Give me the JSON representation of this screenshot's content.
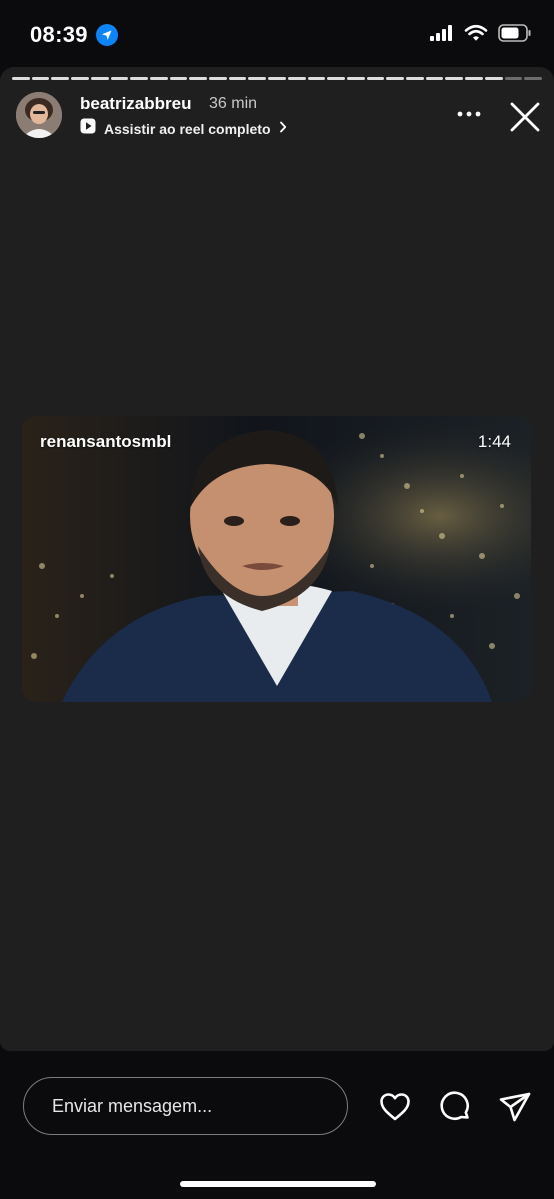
{
  "status_bar": {
    "time": "08:39",
    "icons": [
      "location-arrow-icon",
      "cellular-signal-icon",
      "wifi-icon",
      "battery-icon"
    ]
  },
  "story": {
    "progress_total_segments": 27,
    "progress_viewed_segments": 25,
    "username": "beatrizabbreu",
    "age": "36 min",
    "reel_link_label": "Assistir ao reel completo",
    "icons": [
      "avatar",
      "play-icon",
      "chevron-right-icon",
      "more-icon",
      "close-icon"
    ]
  },
  "video": {
    "author": "renansantosmbl",
    "duration": "1:44"
  },
  "footer": {
    "message_placeholder": "Enviar mensagem...",
    "icons": [
      "heart-icon",
      "comment-icon",
      "send-icon"
    ]
  },
  "colors": {
    "background": "#0b0b0d",
    "story_panel": "#1f1f1f",
    "accent_blue": "#0a84ff",
    "input_border": "#7d7d7d"
  }
}
